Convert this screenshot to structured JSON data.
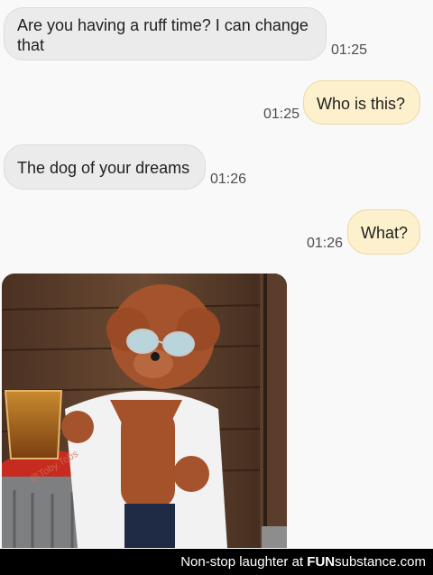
{
  "messages": [
    {
      "text": "Are you having a ruff time? I can change that",
      "time": "01:25",
      "direction": "incoming"
    },
    {
      "text": "Who is this?",
      "time": "01:25",
      "direction": "outgoing"
    },
    {
      "text": "The dog of your dreams",
      "time": "01:26",
      "direction": "incoming"
    },
    {
      "text": "What?",
      "time": "01:26",
      "direction": "outgoing"
    }
  ],
  "image": {
    "watermark": "@Toby.Tobs",
    "subject": "poodle-in-bathrobe-and-sunglasses"
  },
  "footer": {
    "caption": "Non-stop laughter at",
    "brand_bold": "FUN",
    "brand_rest": "substance.com"
  },
  "colors": {
    "incoming_bubble": "#ebebeb",
    "outgoing_bubble": "#fdf0cc",
    "background": "#f9f9f9",
    "footer_bg": "#000000"
  }
}
